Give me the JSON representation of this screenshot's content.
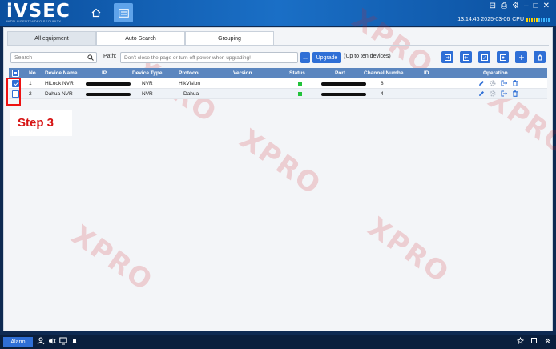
{
  "app": {
    "logo": "iVSEC",
    "logo_subtitle": "INTELLIGENT VIDEO SECURITY"
  },
  "nav": {
    "home_icon": "home-icon",
    "device_icon": "device-list-icon"
  },
  "window_controls": [
    "⊟",
    "⎙",
    "⚙",
    "–",
    "□",
    "✕"
  ],
  "sysinfo": {
    "datetime": "13:14:46 2025-03-06",
    "cpu_label": "CPU"
  },
  "tabs": [
    {
      "label": "All equipment",
      "active": true
    },
    {
      "label": "Auto Search",
      "active": false
    },
    {
      "label": "Grouping",
      "active": false
    }
  ],
  "toolbar": {
    "search_placeholder": "Search",
    "path_label": "Path:",
    "path_placeholder": "Don't close the page or turn off power when upgrading!",
    "browse_label": "...",
    "upgrade_label": "Upgrade",
    "upgrade_note": "(Up to ten devices)"
  },
  "table": {
    "headers": {
      "no": "No.",
      "device_name": "Device Name",
      "ip": "IP",
      "device_type": "Device Type",
      "protocol": "Protocol",
      "version": "Version",
      "status": "Status",
      "port": "Port",
      "channel_number": "Channel Numbe",
      "id": "ID",
      "operation": "Operation"
    },
    "rows": [
      {
        "no": "1",
        "device_name": "HiLook NVR",
        "device_type": "NVR",
        "protocol": "HikVision",
        "version": "",
        "channel_number": "8",
        "id": "",
        "checked": true,
        "status": "online"
      },
      {
        "no": "2",
        "device_name": "Dahua NVR",
        "device_type": "NVR",
        "protocol": "Dahua",
        "version": "",
        "channel_number": "4",
        "id": "",
        "checked": false,
        "status": "online"
      }
    ]
  },
  "annotation": {
    "step_label": "Step 3"
  },
  "bottom": {
    "alarm_label": "Alarm"
  },
  "colors": {
    "accent": "#2f6fd6",
    "header": "#5b86bf",
    "status_online": "#22c23a",
    "annotation": "#e11111"
  }
}
